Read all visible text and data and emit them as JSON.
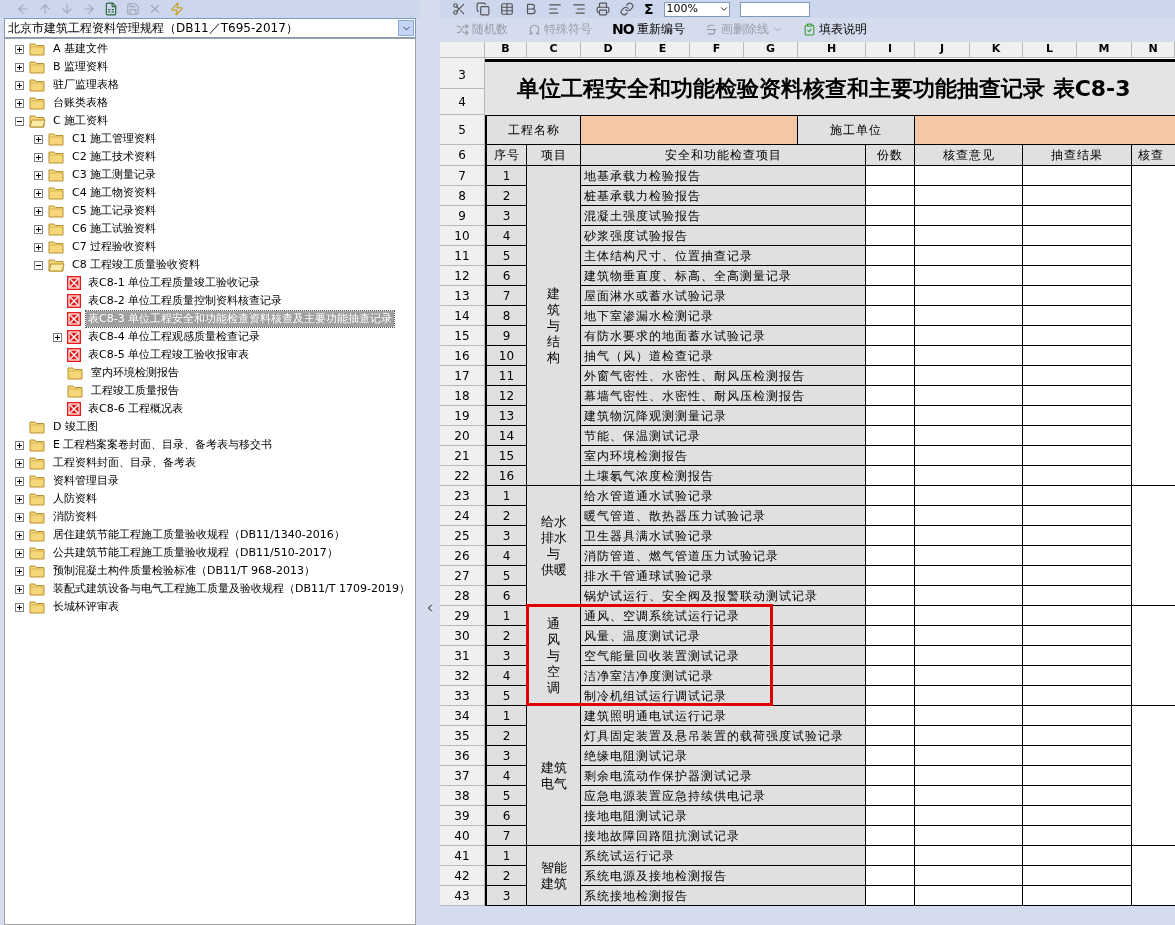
{
  "left_pane": {
    "standard_select": {
      "value": "北京市建筑工程资料管理规程（DB11／T695-2017）"
    },
    "tree": [
      {
        "label": "A 基建文件",
        "kind": "folder",
        "expanded": false,
        "selected": false
      },
      {
        "label": "B 监理资料",
        "kind": "folder",
        "expanded": false,
        "selected": false
      },
      {
        "label": "驻厂监理表格",
        "kind": "folder",
        "expanded": false,
        "selected": false
      },
      {
        "label": "台账类表格",
        "kind": "folder",
        "expanded": false,
        "selected": false
      },
      {
        "label": "C 施工资料",
        "kind": "folder",
        "expanded": true,
        "selected": false,
        "children": [
          {
            "label": "C1 施工管理资料",
            "kind": "folder",
            "expanded": false,
            "selected": false
          },
          {
            "label": "C2 施工技术资料",
            "kind": "folder",
            "expanded": false,
            "selected": false
          },
          {
            "label": "C3 施工测量记录",
            "kind": "folder",
            "expanded": false,
            "selected": false
          },
          {
            "label": "C4 施工物资资料",
            "kind": "folder",
            "expanded": false,
            "selected": false
          },
          {
            "label": "C5 施工记录资料",
            "kind": "folder",
            "expanded": false,
            "selected": false
          },
          {
            "label": "C6 施工试验资料",
            "kind": "folder",
            "expanded": false,
            "selected": false
          },
          {
            "label": "C7 过程验收资料",
            "kind": "folder",
            "expanded": false,
            "selected": false
          },
          {
            "label": "C8 工程竣工质量验收资料",
            "kind": "folder",
            "expanded": true,
            "selected": false,
            "children": [
              {
                "label": "表C8-1 单位工程质量竣工验收记录",
                "kind": "form",
                "selected": false
              },
              {
                "label": "表C8-2 单位工程质量控制资料核查记录",
                "kind": "form",
                "selected": false
              },
              {
                "label": "表C8-3 单位工程安全和功能检查资料核查及主要功能抽查记录",
                "kind": "form",
                "selected": true
              },
              {
                "label": "表C8-4 单位工程观感质量检查记录",
                "kind": "form",
                "expanded": false,
                "selected": false
              },
              {
                "label": "表C8-5 单位工程竣工验收报审表",
                "kind": "form",
                "selected": false
              },
              {
                "label": "室内环境检测报告",
                "kind": "folder",
                "selected": false
              },
              {
                "label": "工程竣工质量报告",
                "kind": "folder",
                "selected": false
              },
              {
                "label": "表C8-6 工程概况表",
                "kind": "form",
                "selected": false
              }
            ]
          }
        ]
      },
      {
        "label": "D 竣工图",
        "kind": "folder",
        "selected": false
      },
      {
        "label": "E 工程档案案卷封面、目录、备考表与移交书",
        "kind": "folder",
        "expanded": false,
        "selected": false
      },
      {
        "label": "工程资料封面、目录、备考表",
        "kind": "folder",
        "expanded": false,
        "selected": false
      },
      {
        "label": "资料管理目录",
        "kind": "folder",
        "expanded": false,
        "selected": false
      },
      {
        "label": "人防资料",
        "kind": "folder",
        "expanded": false,
        "selected": false
      },
      {
        "label": "消防资料",
        "kind": "folder",
        "expanded": false,
        "selected": false
      },
      {
        "label": "居住建筑节能工程施工质量验收规程（DB11/1340-2016）",
        "kind": "folder",
        "expanded": false,
        "selected": false
      },
      {
        "label": "公共建筑节能工程施工质量验收规程（DB11/510-2017）",
        "kind": "folder",
        "expanded": false,
        "selected": false
      },
      {
        "label": "预制混凝土构件质量检验标准（DB11/T 968-2013）",
        "kind": "folder",
        "expanded": false,
        "selected": false
      },
      {
        "label": "装配式建筑设备与电气工程施工质量及验收规程（DB11/T 1709-2019）",
        "kind": "folder",
        "expanded": false,
        "selected": false
      },
      {
        "label": "长城杯评审表",
        "kind": "folder",
        "expanded": false,
        "selected": false
      }
    ]
  },
  "toolbar": {
    "sum_symbol": "Σ",
    "zoom": "100%",
    "buttons": [
      {
        "kind": "random",
        "label": "随机数",
        "disabled": true
      },
      {
        "kind": "symbol",
        "label": "特殊符号",
        "disabled": true
      },
      {
        "kind": "renumber",
        "mark": "NO",
        "label": "重新编号",
        "disabled": false
      },
      {
        "kind": "strike",
        "label": "画删除线",
        "disabled": true
      },
      {
        "kind": "help",
        "label": "填表说明",
        "disabled": false
      }
    ]
  },
  "sheet": {
    "column_headers": [
      "B",
      "C",
      "D",
      "E",
      "F",
      "G",
      "H",
      "I",
      "J",
      "K",
      "L",
      "M",
      "N"
    ],
    "title_row_numbers": [
      "3",
      "4"
    ],
    "title": "单位工程安全和功能检验资料核查和主要功能抽查记录 表C8-3",
    "info_row": {
      "row_number": "5",
      "project_label": "工程名称",
      "contractor_label": "施工单位"
    },
    "header_row": {
      "row_number": "6",
      "seq": "序号",
      "category": "项目",
      "item": "安全和功能检查项目",
      "copies": "份数",
      "review": "核查意见",
      "spot_check": "抽查结果",
      "reviewer": "核查"
    },
    "groups": [
      {
        "label_lines": [
          "建",
          "筑",
          "与",
          "结",
          "构"
        ],
        "highlighted": false,
        "rows": [
          {
            "row": "7",
            "seq": "1",
            "item": "地基承载力检验报告"
          },
          {
            "row": "8",
            "seq": "2",
            "item": "桩基承载力检验报告"
          },
          {
            "row": "9",
            "seq": "3",
            "item": "混凝土强度试验报告"
          },
          {
            "row": "10",
            "seq": "4",
            "item": "砂浆强度试验报告"
          },
          {
            "row": "11",
            "seq": "5",
            "item": "主体结构尺寸、位置抽查记录"
          },
          {
            "row": "12",
            "seq": "6",
            "item": "建筑物垂直度、标高、全高测量记录"
          },
          {
            "row": "13",
            "seq": "7",
            "item": "屋面淋水或蓄水试验记录"
          },
          {
            "row": "14",
            "seq": "8",
            "item": "地下室渗漏水检测记录"
          },
          {
            "row": "15",
            "seq": "9",
            "item": "有防水要求的地面蓄水试验记录"
          },
          {
            "row": "16",
            "seq": "10",
            "item": "抽气（风）道检查记录"
          },
          {
            "row": "17",
            "seq": "11",
            "item": "外窗气密性、水密性、耐风压检测报告"
          },
          {
            "row": "18",
            "seq": "12",
            "item": "幕墙气密性、水密性、耐风压检测报告"
          },
          {
            "row": "19",
            "seq": "13",
            "item": "建筑物沉降观测测量记录"
          },
          {
            "row": "20",
            "seq": "14",
            "item": "节能、保温测试记录"
          },
          {
            "row": "21",
            "seq": "15",
            "item": "室内环境检测报告"
          },
          {
            "row": "22",
            "seq": "16",
            "item": "土壤氡气浓度检测报告"
          }
        ]
      },
      {
        "label_lines": [
          "给水",
          "排水",
          "与",
          "供暖"
        ],
        "highlighted": false,
        "rows": [
          {
            "row": "23",
            "seq": "1",
            "item": "给水管道通水试验记录"
          },
          {
            "row": "24",
            "seq": "2",
            "item": "暖气管道、散热器压力试验记录"
          },
          {
            "row": "25",
            "seq": "3",
            "item": "卫生器具满水试验记录"
          },
          {
            "row": "26",
            "seq": "4",
            "item": "消防管道、燃气管道压力试验记录"
          },
          {
            "row": "27",
            "seq": "5",
            "item": "排水干管通球试验记录"
          },
          {
            "row": "28",
            "seq": "6",
            "item": "锅炉试运行、安全阀及报警联动测试记录"
          }
        ]
      },
      {
        "label_lines": [
          "通",
          "风",
          "与",
          "空",
          "调"
        ],
        "highlighted": true,
        "rows": [
          {
            "row": "29",
            "seq": "1",
            "item": "通风、空调系统试运行记录"
          },
          {
            "row": "30",
            "seq": "2",
            "item": "风量、温度测试记录"
          },
          {
            "row": "31",
            "seq": "3",
            "item": "空气能量回收装置测试记录"
          },
          {
            "row": "32",
            "seq": "4",
            "item": "洁净室洁净度测试记录"
          },
          {
            "row": "33",
            "seq": "5",
            "item": "制冷机组试运行调试记录"
          }
        ]
      },
      {
        "label_lines": [
          "建筑",
          "电气"
        ],
        "highlighted": false,
        "rows": [
          {
            "row": "34",
            "seq": "1",
            "item": "建筑照明通电试运行记录"
          },
          {
            "row": "35",
            "seq": "2",
            "item": "灯具固定装置及悬吊装置的载荷强度试验记录"
          },
          {
            "row": "36",
            "seq": "3",
            "item": "绝缘电阻测试记录"
          },
          {
            "row": "37",
            "seq": "4",
            "item": "剩余电流动作保护器测试记录"
          },
          {
            "row": "38",
            "seq": "5",
            "item": "应急电源装置应急持续供电记录"
          },
          {
            "row": "39",
            "seq": "6",
            "item": "接地电阻测试记录"
          },
          {
            "row": "40",
            "seq": "7",
            "item": "接地故障回路阻抗测试记录"
          }
        ]
      },
      {
        "label_lines": [
          "智能",
          "建筑"
        ],
        "highlighted": false,
        "rows": [
          {
            "row": "41",
            "seq": "1",
            "item": "系统试运行记录"
          },
          {
            "row": "42",
            "seq": "2",
            "item": "系统电源及接地检测报告"
          },
          {
            "row": "43",
            "seq": "3",
            "item": "系统接地检测报告"
          }
        ]
      }
    ]
  }
}
